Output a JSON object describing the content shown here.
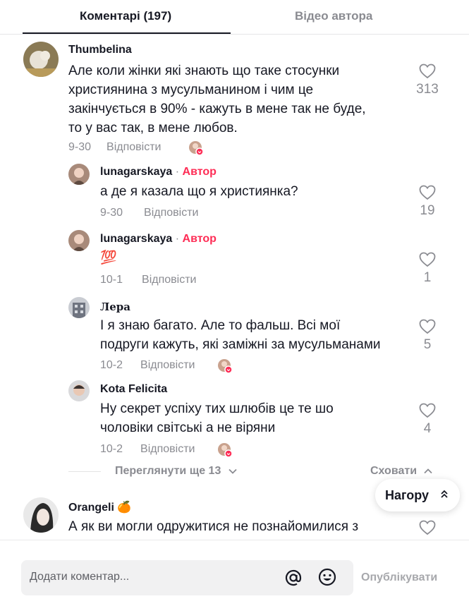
{
  "tabs": [
    {
      "label": "Коментарі (197)",
      "active": true
    },
    {
      "label": "Відео автора",
      "active": false
    }
  ],
  "comments": [
    {
      "author": "Thumbelina",
      "text_lines": [
        "Але коли жінки які знають що таке стосунки",
        "християнина з мусульманином і чим це",
        "закінчується в 90% - кажуть в мене так не буде,",
        "то у вас так, в мене любов."
      ],
      "date": "9-30",
      "reply_label": "Відповісти",
      "likes": "313",
      "liked_by_author": true
    },
    {
      "author": "lunagarskaya",
      "author_tag": "Автор",
      "separator": "·",
      "text_lines": [
        "а де я казала що я християнка?"
      ],
      "date": "9-30",
      "reply_label": "Відповісти",
      "likes": "19",
      "liked_by_author": false
    },
    {
      "author": "lunagarskaya",
      "author_tag": "Автор",
      "separator": "·",
      "text_lines": [
        "💯"
      ],
      "date": "10-1",
      "reply_label": "Відповісти",
      "likes": "1",
      "liked_by_author": false
    },
    {
      "author": "Лера",
      "text_lines": [
        "І я знаю багато. Але то фальш. Всі мої",
        "подруги кажуть, які заміжні за мусульманами"
      ],
      "date": "10-2",
      "reply_label": "Відповісти",
      "likes": "5",
      "liked_by_author": true
    },
    {
      "author": "Kota Felicita",
      "text_lines": [
        "Ну секрет успіху тих шлюбів це те шо",
        "чоловіки світські а не віряни"
      ],
      "date": "10-2",
      "reply_label": "Відповісти",
      "likes": "4",
      "liked_by_author": true
    },
    {
      "author": "Orangeli 🍊",
      "text_lines": [
        "А як ви могли одружитися не познайомилися з"
      ],
      "likes": ""
    }
  ],
  "replies_controls": {
    "view_more": "Переглянути ще 13",
    "hide": "Сховати"
  },
  "scroll_top_button": "Нагору",
  "composer": {
    "placeholder": "Додати коментар...",
    "post_label": "Опублікувати"
  },
  "colors": {
    "accent": "#fe2c55",
    "text": "#161823",
    "muted": "#8a8b91"
  }
}
